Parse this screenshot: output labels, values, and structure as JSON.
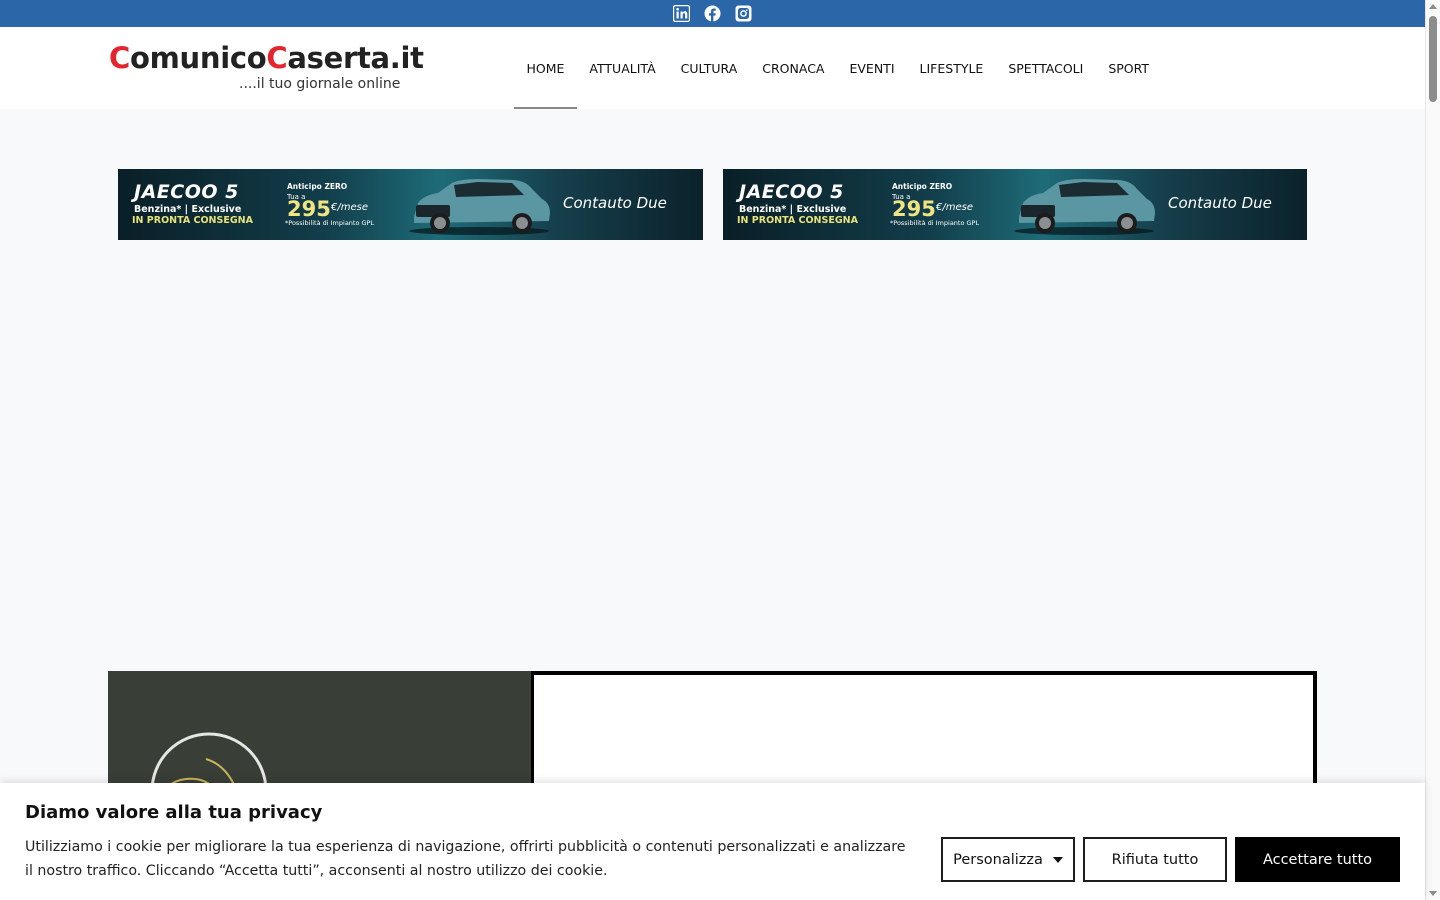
{
  "topbar": {
    "color": "#2a66a8",
    "icons": [
      "linkedin-icon",
      "facebook-icon",
      "instagram-icon"
    ]
  },
  "logo": {
    "part1_first": "C",
    "part1_rest": "omunico",
    "part2_first": "C",
    "part2_rest": "aserta.it",
    "tagline": "....il tuo giornale online",
    "accent_color": "#e3262e"
  },
  "nav": {
    "items": [
      {
        "label": "HOME",
        "active": true
      },
      {
        "label": "ATTUALITÀ"
      },
      {
        "label": "CULTURA"
      },
      {
        "label": "CRONACA"
      },
      {
        "label": "EVENTI"
      },
      {
        "label": "LIFESTYLE"
      },
      {
        "label": "SPETTACOLI"
      },
      {
        "label": "SPORT"
      }
    ]
  },
  "banner": {
    "model": "JAECOO 5",
    "fuel": "Benzina* | Exclusive",
    "ready": "IN PRONTA CONSEGNA",
    "offer": "Anticipo ZERO",
    "tua": "Tua a",
    "price": "295",
    "per_month": "€/mese",
    "note": "*Possibilità di Impianto GPL",
    "dealer": "Contauto Due"
  },
  "cookie": {
    "title": "Diamo valore alla tua privacy",
    "text": "Utilizziamo i cookie per migliorare la tua esperienza di navigazione, offrirti pubblicità o contenuti personalizzati e analizzare il nostro traffico. Cliccando “Accetta tutti”, acconsenti al nostro utilizzo dei cookie.",
    "customize_label": "Personalizza",
    "reject_label": "Rifiuta tutto",
    "accept_label": "Accettare tutto"
  }
}
